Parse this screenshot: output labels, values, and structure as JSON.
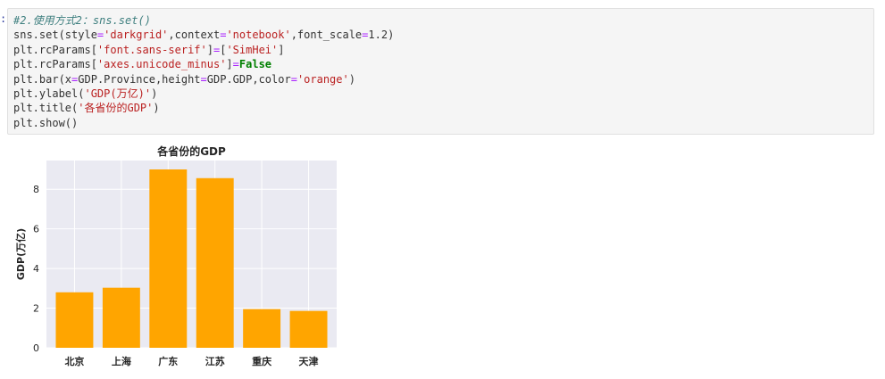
{
  "notebook": {
    "prompt": ":",
    "code_lines": [
      [
        {
          "t": "#2.使用方式2：sns.set()",
          "c": "comment"
        }
      ],
      [
        {
          "t": "sns.set(style"
        },
        {
          "t": "=",
          "c": "op"
        },
        {
          "t": "'darkgrid'",
          "c": "string"
        },
        {
          "t": ",context"
        },
        {
          "t": "=",
          "c": "op"
        },
        {
          "t": "'notebook'",
          "c": "string"
        },
        {
          "t": ",font_scale"
        },
        {
          "t": "=",
          "c": "op"
        },
        {
          "t": "1.2)"
        }
      ],
      [
        {
          "t": "plt.rcParams["
        },
        {
          "t": "'font.sans-serif'",
          "c": "string"
        },
        {
          "t": "]"
        },
        {
          "t": "=",
          "c": "op"
        },
        {
          "t": "["
        },
        {
          "t": "'SimHei'",
          "c": "string"
        },
        {
          "t": "]"
        }
      ],
      [
        {
          "t": "plt.rcParams["
        },
        {
          "t": "'axes.unicode_minus'",
          "c": "string"
        },
        {
          "t": "]"
        },
        {
          "t": "=",
          "c": "op"
        },
        {
          "t": "False",
          "c": "keyword"
        }
      ],
      [
        {
          "t": "plt.bar(x"
        },
        {
          "t": "=",
          "c": "op"
        },
        {
          "t": "GDP.Province,height"
        },
        {
          "t": "=",
          "c": "op"
        },
        {
          "t": "GDP.GDP,color"
        },
        {
          "t": "=",
          "c": "op"
        },
        {
          "t": "'orange'",
          "c": "string"
        },
        {
          "t": ")"
        }
      ],
      [
        {
          "t": "plt.ylabel("
        },
        {
          "t": "'GDP(万亿)'",
          "c": "string"
        },
        {
          "t": ")"
        }
      ],
      [
        {
          "t": "plt.title("
        },
        {
          "t": "'各省份的GDP'",
          "c": "string"
        },
        {
          "t": ")"
        }
      ],
      [
        {
          "t": "plt.show()"
        }
      ]
    ]
  },
  "chart_data": {
    "type": "bar",
    "title": "各省份的GDP",
    "xlabel": "",
    "ylabel": "GDP(万亿)",
    "categories": [
      "北京",
      "上海",
      "广东",
      "江苏",
      "重庆",
      "天津"
    ],
    "values": [
      2.8,
      3.03,
      9.0,
      8.56,
      1.95,
      1.86
    ],
    "ylim": [
      0,
      9.45
    ],
    "yticks": [
      0,
      2,
      4,
      6,
      8
    ],
    "bar_color": "#ffa500",
    "background_color": "#eaeaf2",
    "grid_color": "#ffffff",
    "grid": true,
    "style": "darkgrid"
  }
}
